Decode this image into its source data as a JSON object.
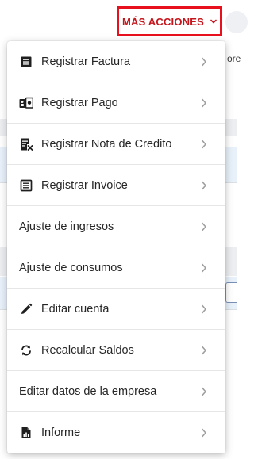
{
  "colors": {
    "accent_red": "#c4161c",
    "accent_border": "#e8101c",
    "menu_text": "#262626",
    "arrow": "#9e9e9e"
  },
  "header": {
    "more_actions_label": "MÁS ACCIONES",
    "more_actions_icon": "chevron-down-icon"
  },
  "background": {
    "partial_text": "ore"
  },
  "menu": {
    "items": [
      {
        "label": "Registrar Factura",
        "icon": "invoice-icon",
        "arrow_icon": "chevron-right-icon"
      },
      {
        "label": "Registrar Pago",
        "icon": "payment-card-icon",
        "arrow_icon": "chevron-right-icon"
      },
      {
        "label": "Registrar Nota de Credito",
        "icon": "credit-note-icon",
        "arrow_icon": "chevron-right-icon"
      },
      {
        "label": "Registrar Invoice",
        "icon": "list-document-icon",
        "arrow_icon": "chevron-right-icon"
      },
      {
        "label": "Ajuste de ingresos",
        "icon": "",
        "arrow_icon": "chevron-right-icon"
      },
      {
        "label": "Ajuste de consumos",
        "icon": "",
        "arrow_icon": "chevron-right-icon"
      },
      {
        "label": "Editar cuenta",
        "icon": "pencil-icon",
        "arrow_icon": "chevron-right-icon"
      },
      {
        "label": "Recalcular Saldos",
        "icon": "refresh-icon",
        "arrow_icon": "chevron-right-icon"
      },
      {
        "label": "Editar datos de la empresa",
        "icon": "",
        "arrow_icon": "chevron-right-icon"
      },
      {
        "label": "Informe",
        "icon": "report-chart-icon",
        "arrow_icon": "chevron-right-icon"
      }
    ]
  }
}
